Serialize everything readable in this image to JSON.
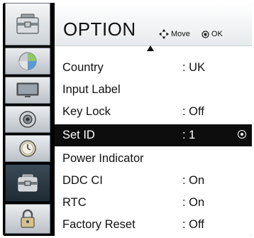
{
  "header": {
    "title": "OPTION",
    "nav_move_icon": "four-way-arrows-icon",
    "nav_move_label": "Move",
    "nav_ok_icon": "ok-circle-icon",
    "nav_ok_label": "OK"
  },
  "sidebar": {
    "items": [
      {
        "icon": "option-toolbox-icon"
      },
      {
        "icon": "picture-icon"
      },
      {
        "icon": "tv-screen-icon"
      },
      {
        "icon": "speaker-icon"
      },
      {
        "icon": "clock-icon"
      },
      {
        "icon": "option-toolbox-icon",
        "selected": true
      },
      {
        "icon": "lock-icon"
      }
    ]
  },
  "menu": {
    "items": [
      {
        "label": "Country",
        "value": ": UK"
      },
      {
        "label": "Input Label",
        "value": ""
      },
      {
        "label": "Key Lock",
        "value": ": Off"
      },
      {
        "label": "Set ID",
        "value": ": 1",
        "selected": true
      },
      {
        "label": "Power Indicator",
        "value": ""
      },
      {
        "label": "DDC CI",
        "value": ": On"
      },
      {
        "label": "RTC",
        "value": ": On"
      },
      {
        "label": "Factory Reset",
        "value": ": Off"
      }
    ]
  },
  "colors": {
    "frame": "#000000",
    "panel": "#ffffff",
    "selected_row": "#0d0d0d",
    "selected_text": "#ffffff"
  }
}
